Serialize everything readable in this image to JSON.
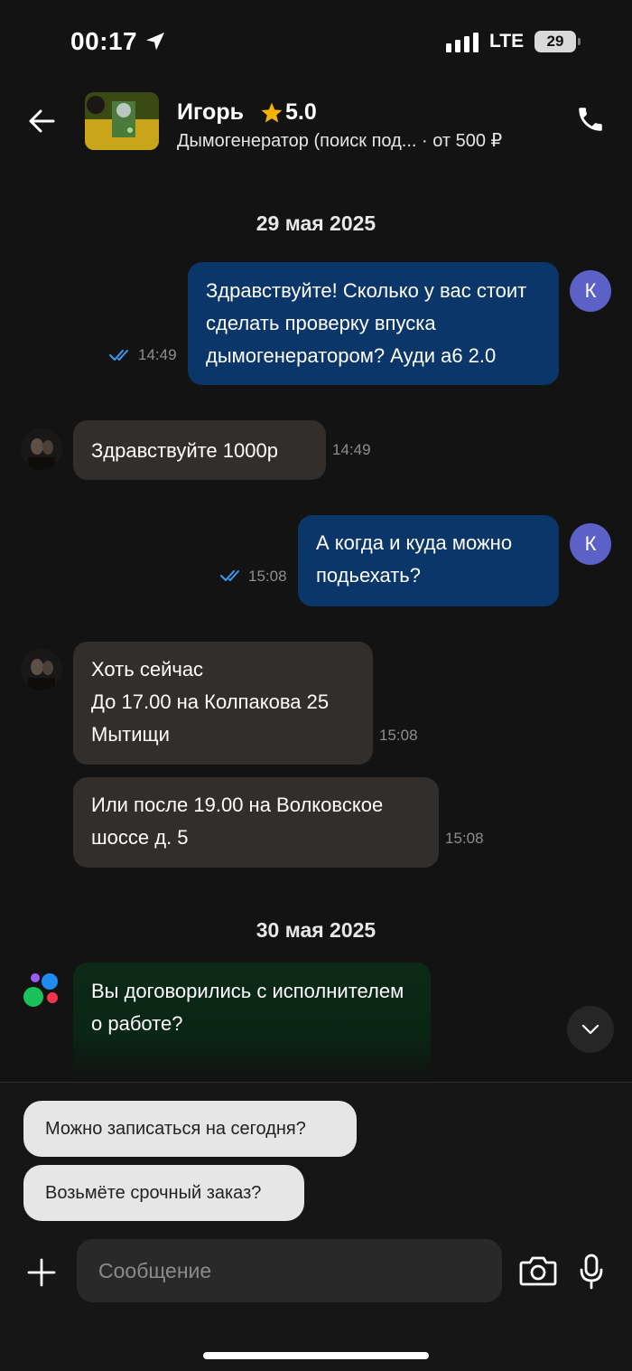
{
  "status_bar": {
    "time": "00:17",
    "network": "LTE",
    "battery": "29"
  },
  "header": {
    "title": "Игорь",
    "rating": "5.0",
    "subtitle": "Дымогенератор (поиск под...",
    "price": " · от 500 ₽",
    "star_color": "#f5b301"
  },
  "dates": [
    "29 мая 2025",
    "30 мая 2025"
  ],
  "messages": [
    {
      "side": "out",
      "text": "Здравствуйте! Сколько у вас стоит сделать проверку впуска дымогенератором? Ауди а6 2.0",
      "time": "14:49",
      "avatar": "К"
    },
    {
      "side": "in",
      "text": "Здравствуйте 1000р",
      "time": "14:49"
    },
    {
      "side": "out",
      "text": "А когда и куда можно подьехать?",
      "time": "15:08",
      "avatar": "К"
    },
    {
      "side": "in",
      "text": "Хоть сейчас\nДо 17.00 на Колпакова 25\nМытищи",
      "time": "15:08"
    },
    {
      "side": "in",
      "text": "Или после 19.00 на Волковское шоссе д. 5",
      "time": "15:08"
    },
    {
      "side": "system",
      "text": "Вы договорились с исполнителем о работе?"
    }
  ],
  "quick_replies": [
    "Можно записаться на сегодня?",
    "Возьмёте срочный заказ?"
  ],
  "composer": {
    "placeholder": "Сообщение"
  },
  "colors": {
    "outgoing": "#0b3669",
    "incoming": "#322e2b",
    "system": "#0c2a17",
    "read_check": "#3a9bf0",
    "avatar": "#5b61c7"
  }
}
